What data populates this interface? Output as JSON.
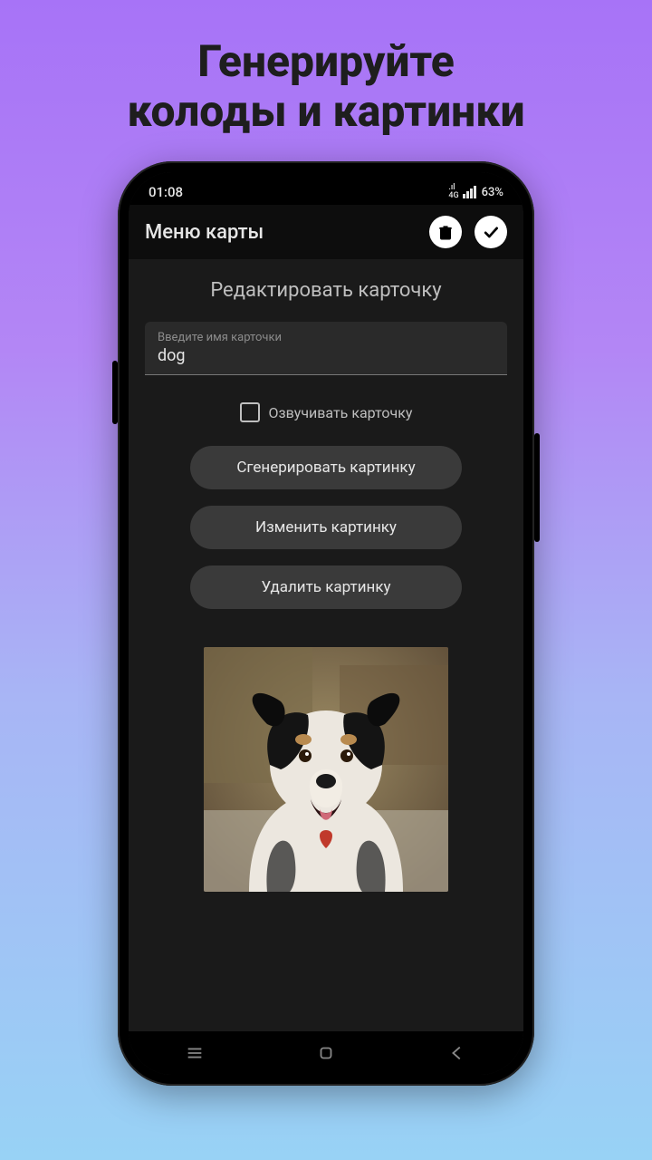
{
  "promo": {
    "line1": "Генерируйте",
    "line2": "колоды и картинки"
  },
  "status": {
    "time": "01:08",
    "net": "4G",
    "battery": "63%"
  },
  "appbar": {
    "title": "Меню карты"
  },
  "editor": {
    "heading": "Редактировать карточку",
    "name_hint": "Введите имя карточки",
    "name_value": "dog",
    "voice_label": "Озвучивать карточку",
    "btn_generate": "Сгенерировать картинку",
    "btn_change": "Изменить картинку",
    "btn_delete": "Удалить картинку"
  }
}
